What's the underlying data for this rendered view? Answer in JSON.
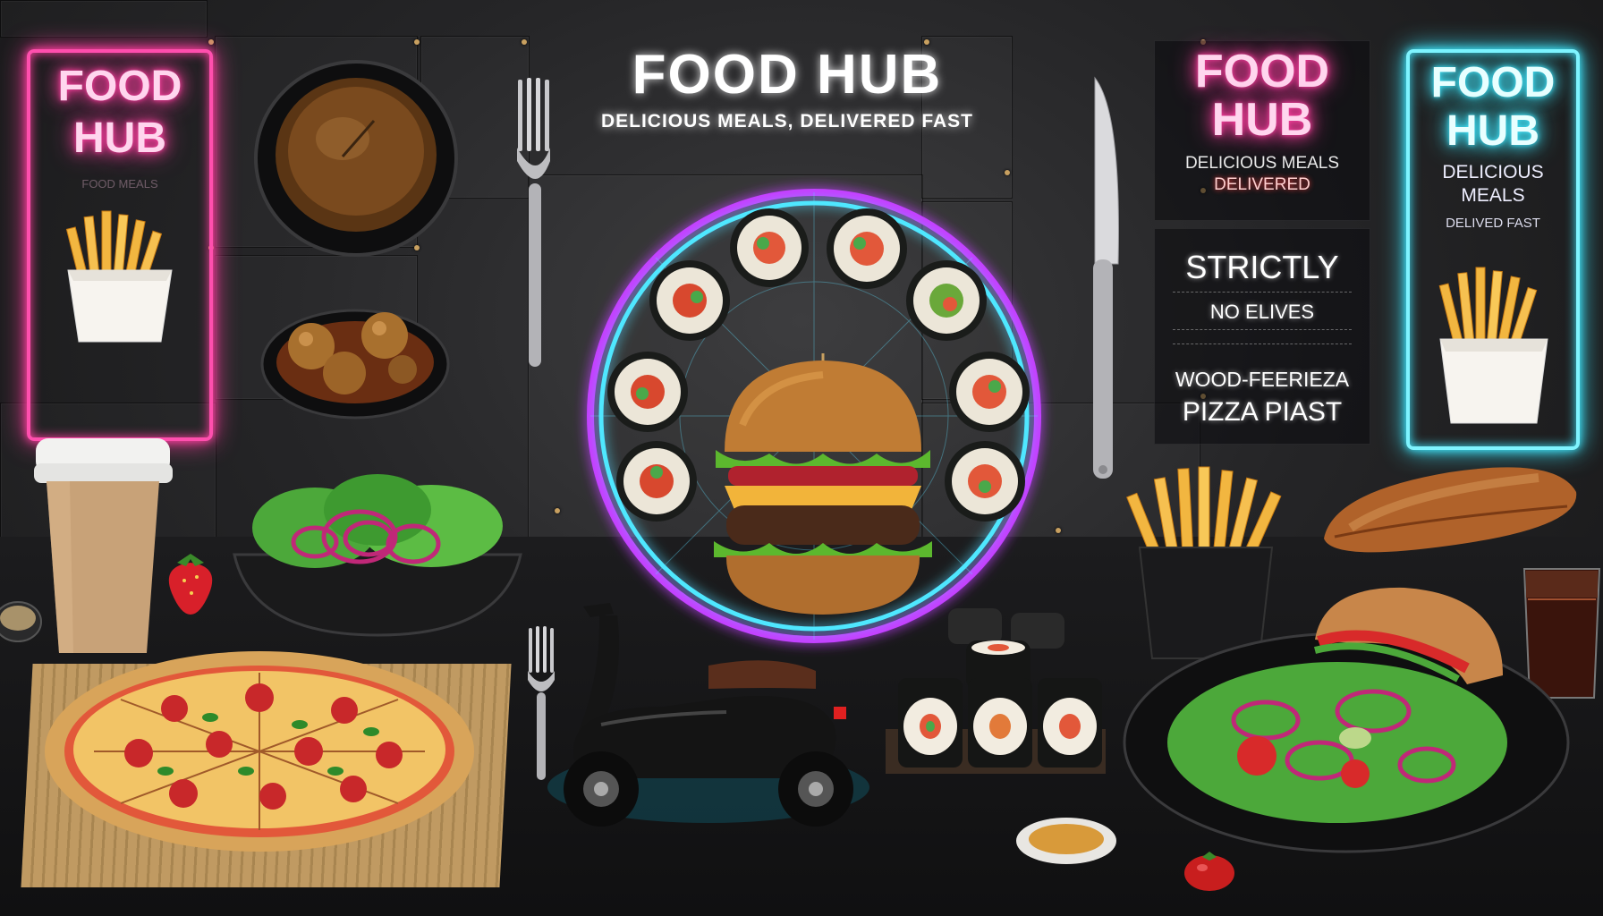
{
  "colors": {
    "neon_pink": "#ff4fae",
    "neon_cyan": "#7ff4ff",
    "neon_ring_outer": "#c63cff",
    "neon_ring_inner": "#4fe7ff",
    "background": "#2a2a2c"
  },
  "headline": {
    "title": "FOOD HUB",
    "tagline": "DELICIOUS MEALS, DELIVERED FAST"
  },
  "left_sign": {
    "line1": "FOOD",
    "line2": "HUB",
    "faint": "FOOD MEALS"
  },
  "center_right_sign": {
    "line1": "FOOD",
    "line2": "HUB",
    "sub1": "DELICIOUS MEALS",
    "sub2": "DELIVERED"
  },
  "menu_board": {
    "line1": "STRICTLY",
    "line2": "NO ELIVES",
    "line3": "WOOD-FEERIEZA",
    "line4": "PIZZA PIAST"
  },
  "right_sign": {
    "line1": "FOOD",
    "line2": "HUB",
    "sub1": "DELICIOUS",
    "sub2": "MEALS",
    "sub3": "DELIVED FAST"
  },
  "icons": {
    "fries_left": "french-fries-icon",
    "fries_right": "french-fries-icon",
    "fries_table": "french-fries-icon",
    "burger": "burger-icon",
    "sushi": "sushi-roll-icon",
    "pizza": "pizza-icon",
    "scooter": "delivery-scooter-icon",
    "coffee": "coffee-cup-icon",
    "salad": "salad-bowl-icon",
    "fork": "fork-icon",
    "knife": "knife-icon",
    "bread": "baguette-icon",
    "sandwich": "sandwich-icon",
    "drink": "drink-glass-icon",
    "strawberry": "strawberry-icon",
    "soup": "soup-bowl-icon",
    "potatoes": "roasted-potatoes-icon",
    "sauce": "sauce-dish-icon",
    "tomato": "cherry-tomato-icon"
  }
}
